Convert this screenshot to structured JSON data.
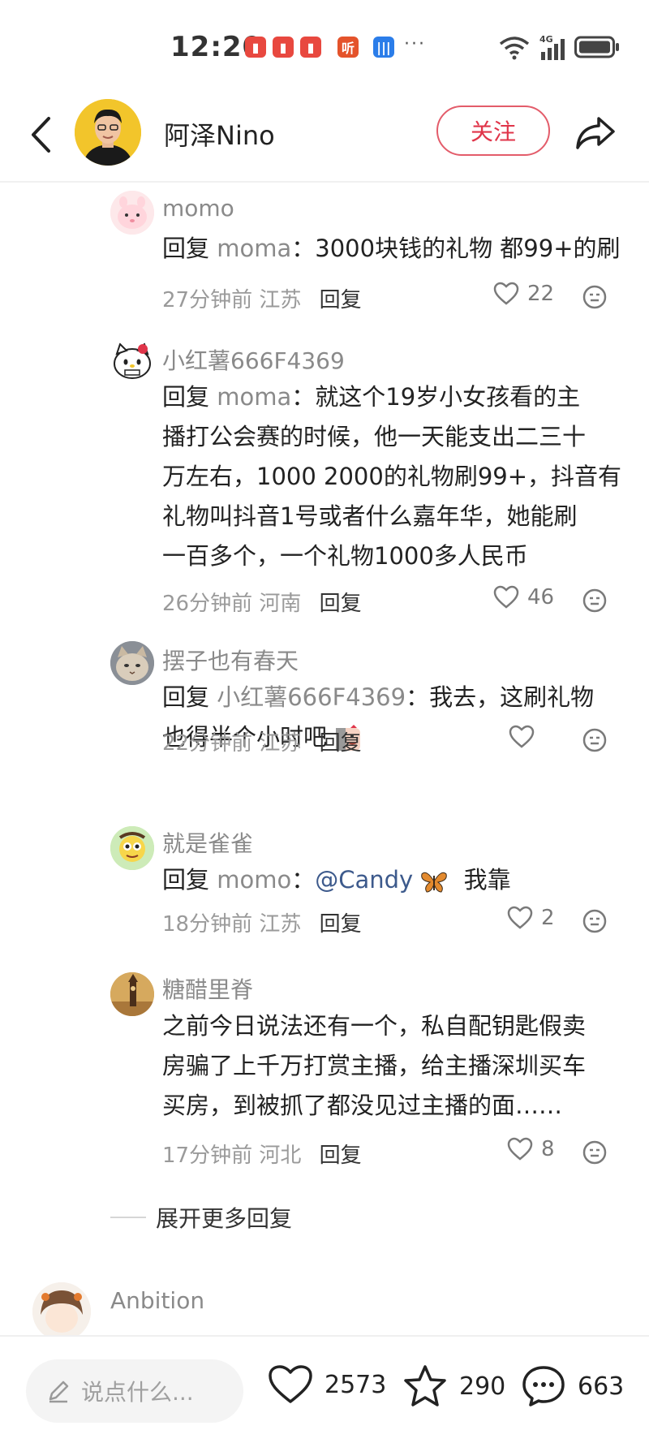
{
  "status": {
    "time": "12:20",
    "icons": [
      "book-app-icon",
      "book-app-icon",
      "book-app-icon",
      "listen-app-icon",
      "voice-app-icon"
    ],
    "listen_label": "听",
    "network": "4G"
  },
  "header": {
    "author_name": "阿泽Nino",
    "follow_label": "关注"
  },
  "comments": [
    {
      "name": "momo",
      "reply_word": "回复",
      "reply_target": "moma",
      "sep": "：",
      "lines": [
        "3000块钱的礼物 都99+的刷"
      ],
      "time": "27分钟前",
      "location": "江苏",
      "reply_label": "回复",
      "likes": "22"
    },
    {
      "name": "小红薯666F4369",
      "reply_word": "回复",
      "reply_target": "moma",
      "sep": "：",
      "lines": [
        "就这个19岁小女孩看的主",
        "播打公会赛的时候，他一天能支出二三十",
        "万左右，1000 2000的礼物刷99+，抖音有",
        "礼物叫抖音1号或者什么嘉年华，她能刷",
        "一百多个，一个礼物1000多人民币"
      ],
      "time": "26分钟前",
      "location": "河南",
      "reply_label": "回复",
      "likes": "46"
    },
    {
      "name": "摆子也有春天",
      "reply_word": "回复",
      "reply_target": "小红薯666F4369",
      "sep": "：",
      "lines": [
        "我去，这刷礼物",
        "也得半个小时吧"
      ],
      "time": "22分钟前",
      "location": "江苏",
      "reply_label": "回复",
      "likes": ""
    },
    {
      "name": "就是雀雀",
      "reply_word": "回复",
      "reply_target": "momo",
      "sep": "：",
      "mention": "@Candy",
      "lines": [
        "我靠"
      ],
      "time": "18分钟前",
      "location": "江苏",
      "reply_label": "回复",
      "likes": "2"
    },
    {
      "name": "糖醋里脊",
      "lines": [
        "之前今日说法还有一个，私自配钥匙假卖",
        "房骗了上千万打赏主播，给主播深圳买车",
        "买房，到被抓了都没见过主播的面……"
      ],
      "time": "17分钟前",
      "location": "河北",
      "reply_label": "回复",
      "likes": "8"
    }
  ],
  "expand_more": "展开更多回复",
  "next_comment": {
    "name": "Anbition"
  },
  "bottom_bar": {
    "say_placeholder": "说点什么...",
    "likes": "2573",
    "stars": "290",
    "comments": "663"
  },
  "colors": {
    "accent": "#e0354a",
    "mention": "#3d5a8c",
    "secondary_text": "#8a8a8a"
  }
}
